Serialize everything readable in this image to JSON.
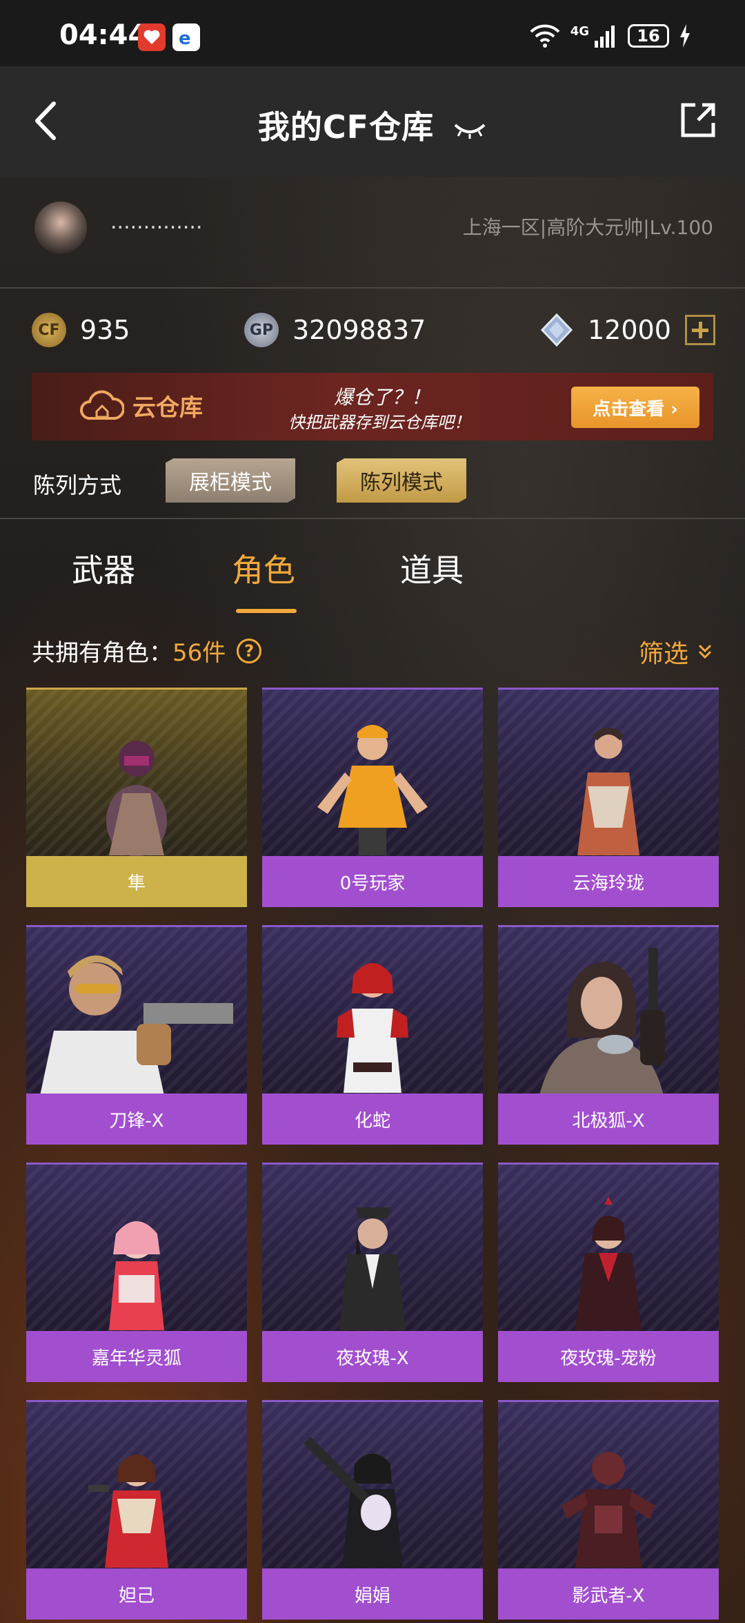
{
  "status_bar": {
    "time": "04:44",
    "network": "4G",
    "battery": "16"
  },
  "nav": {
    "title": "我的CF仓库"
  },
  "profile": {
    "nickname": "..............",
    "server": "上海一区|高阶大元帅|Lv.100"
  },
  "currencies": [
    {
      "name": "cf-coin",
      "value": "935",
      "icon_text": "CF"
    },
    {
      "name": "gp",
      "value": "32098837",
      "icon_text": "GP"
    },
    {
      "name": "diamond",
      "value": "12000"
    }
  ],
  "banner": {
    "title": "云仓库",
    "line1": "爆仓了？！",
    "line2": "快把武器存到云仓库吧！",
    "button": "点击查看 ›"
  },
  "display_mode": {
    "label": "陈列方式",
    "options": [
      "展柜模式",
      "陈列模式"
    ]
  },
  "tabs": [
    {
      "label": "武器"
    },
    {
      "label": "角色",
      "active": true
    },
    {
      "label": "道具"
    }
  ],
  "summary": {
    "prefix": "共拥有角色：",
    "count": "56件",
    "filter": "筛选"
  },
  "characters": [
    {
      "name": "隼",
      "rarity": "gold"
    },
    {
      "name": "0号玩家",
      "rarity": "purple"
    },
    {
      "name": "云海玲珑",
      "rarity": "purple"
    },
    {
      "name": "刀锋-X",
      "rarity": "purple"
    },
    {
      "name": "化蛇",
      "rarity": "purple"
    },
    {
      "name": "北极狐-X",
      "rarity": "purple"
    },
    {
      "name": "嘉年华灵狐",
      "rarity": "purple"
    },
    {
      "name": "夜玫瑰-X",
      "rarity": "purple"
    },
    {
      "name": "夜玫瑰-宠粉",
      "rarity": "purple"
    },
    {
      "name": "妲己",
      "rarity": "purple"
    },
    {
      "name": "娟娟",
      "rarity": "purple"
    },
    {
      "name": "影武者-X",
      "rarity": "purple"
    }
  ]
}
